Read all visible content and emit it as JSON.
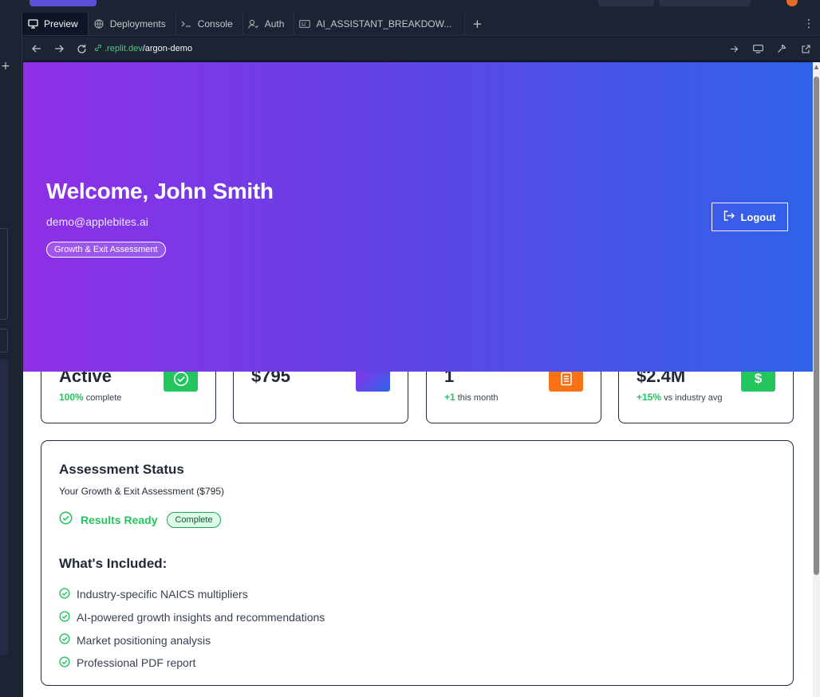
{
  "browser": {
    "tabs": [
      {
        "label": "Preview",
        "icon": "monitor-icon",
        "active": true
      },
      {
        "label": "Deployments",
        "icon": "globe-icon",
        "active": false
      },
      {
        "label": "Console",
        "icon": "terminal-icon",
        "active": false
      },
      {
        "label": "Auth",
        "icon": "user-icon",
        "active": false
      },
      {
        "label": "AI_ASSISTANT_BREAKDOW...",
        "icon": "file-icon",
        "active": false
      }
    ],
    "add_tab": "+",
    "more": "⋮",
    "url": {
      "domain": ".replit.dev",
      "path": "/argon-demo"
    }
  },
  "hero": {
    "title": "Welcome, John Smith",
    "email": "demo@applebites.ai",
    "badge": "Growth & Exit Assessment",
    "logout_label": "Logout"
  },
  "stats": [
    {
      "value": "Active",
      "highlight": "100%",
      "caption": "complete",
      "icon": "check-circle-icon",
      "color": "#22c55e"
    },
    {
      "value": "$795",
      "highlight": "",
      "caption": "",
      "icon": "gradient-square-icon",
      "color": "#6342e6"
    },
    {
      "value": "1",
      "highlight": "+1",
      "caption": "this month",
      "icon": "document-icon",
      "color": "#f97316"
    },
    {
      "value": "$2.4M",
      "highlight": "+15%",
      "caption": "vs industry avg",
      "icon": "dollar-icon",
      "color": "#22c55e"
    }
  ],
  "assessment": {
    "title": "Assessment Status",
    "subtitle": "Your Growth & Exit Assessment ($795)",
    "status": "Results Ready",
    "badge": "Complete",
    "included_title": "What's Included:",
    "items": [
      "Industry-specific NAICS multipliers",
      "AI-powered growth insights and recommendations",
      "Market positioning analysis",
      "Professional PDF report"
    ]
  },
  "colors": {
    "accent_green": "#22c55e",
    "gradient_start": "#8f2fe6",
    "gradient_end": "#2f63e8",
    "card_border": "#1e2a4a"
  }
}
